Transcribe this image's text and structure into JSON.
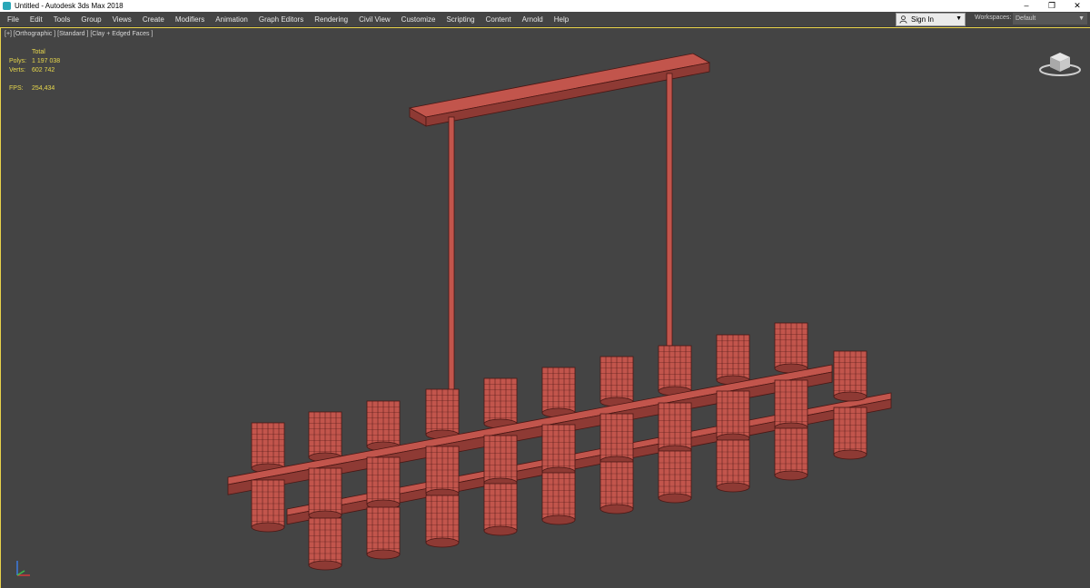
{
  "window": {
    "title": "Untitled - Autodesk 3ds Max 2018",
    "controls": {
      "minimize": "–",
      "restore": "❐",
      "close": "✕"
    }
  },
  "menu": {
    "items": [
      "File",
      "Edit",
      "Tools",
      "Group",
      "Views",
      "Create",
      "Modifiers",
      "Animation",
      "Graph Editors",
      "Rendering",
      "Civil View",
      "Customize",
      "Scripting",
      "Content",
      "Arnold",
      "Help"
    ],
    "sign_in": "Sign In",
    "workspaces_label": "Workspaces:",
    "workspace_value": "Default"
  },
  "viewport": {
    "label": "[+] [Orthographic ] [Standard ] [Clay + Edged Faces ]",
    "stats": {
      "header": "Total",
      "polys_label": "Polys:",
      "polys_value": "1 197 038",
      "verts_label": "Verts:",
      "verts_value": "602 742",
      "fps_label": "FPS:",
      "fps_value": "254,434"
    }
  },
  "colors": {
    "model": "#c2554c",
    "model_dark": "#8e3a34",
    "wire": "#4a1714",
    "stats": "#e8d84c",
    "active_border": "#e9d24a"
  }
}
